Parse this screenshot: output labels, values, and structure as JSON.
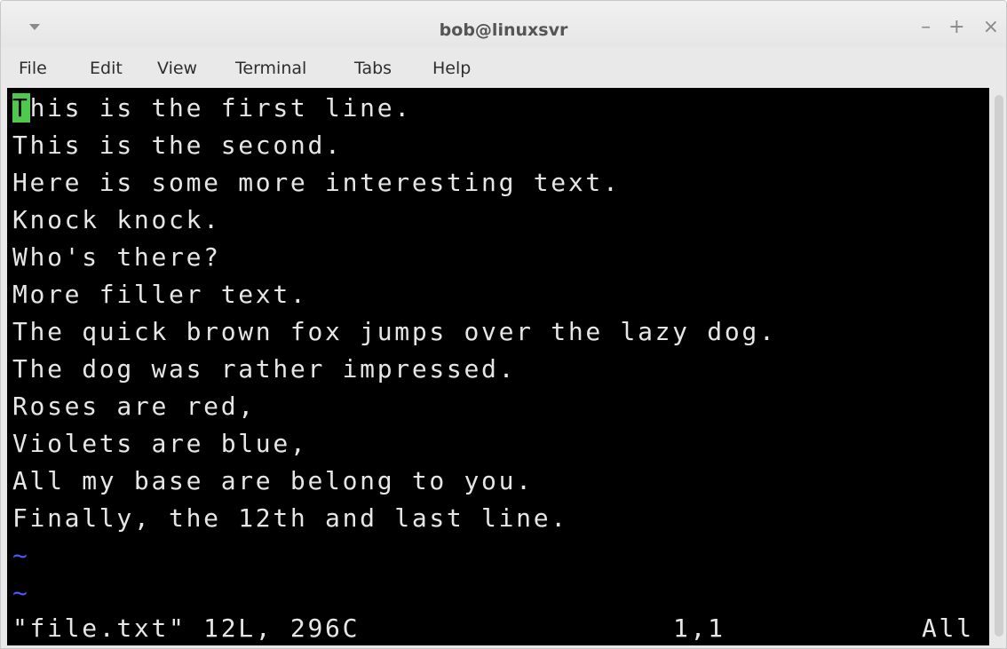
{
  "window": {
    "title": "bob@linuxsvr",
    "controls": {
      "minimize": "–",
      "maximize": "+",
      "close": "×"
    }
  },
  "menu": {
    "items": [
      "File",
      "Edit",
      "View",
      "Terminal",
      "Tabs",
      "Help"
    ]
  },
  "editor": {
    "cursor_char": "T",
    "lines": [
      "This is the first line.",
      "This is the second.",
      "Here is some more interesting text.",
      "Knock knock.",
      "Who's there?",
      "More filler text.",
      "The quick brown fox jumps over the lazy dog.",
      "The dog was rather impressed.",
      "Roses are red,",
      "Violets are blue,",
      "All my base are belong to you.",
      "Finally, the 12th and last line."
    ],
    "first_line_rest": "his is the first line.",
    "empty_marker": "~",
    "status": {
      "file_info": "\"file.txt\" 12L, 296C",
      "position": "1,1",
      "scroll": "All"
    }
  },
  "colors": {
    "cursor": "#4ec94e",
    "tilde": "#4a59ff",
    "background": "#000000",
    "text": "#e6e6e6"
  }
}
